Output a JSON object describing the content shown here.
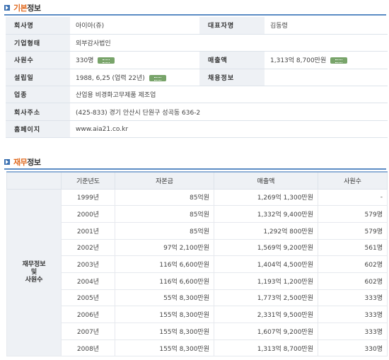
{
  "basic_section": {
    "title_accent": "기본",
    "title_rest": "정보"
  },
  "basic": {
    "rows": [
      {
        "label": "회사명",
        "value": "아이아(쥬)",
        "label2": "대표자명",
        "value2": "김동령"
      },
      {
        "label": "기업형태",
        "value": "외부감사법인"
      },
      {
        "label": "사원수",
        "value": "330명",
        "label2": "매출액",
        "value2": "1,313억 8,700만원"
      },
      {
        "label": "설립일",
        "value": "1988, 6,25 (업력 22년)",
        "label2": "채용정보",
        "value2": ""
      },
      {
        "label": "업종",
        "value": "산업용 비경화고무제품 제조업"
      },
      {
        "label": "회사주소",
        "value": "(425-833) 경기 안산시 단원구 성곡동 636-2"
      },
      {
        "label": "홈페이지",
        "value": "www.aia21.co.kr"
      }
    ]
  },
  "finance_section": {
    "title_accent": "재무",
    "title_rest": "정보"
  },
  "finance": {
    "side_label_lines": [
      "재무정보",
      "및",
      "사원수"
    ],
    "headers": [
      "기준년도",
      "자본금",
      "매출액",
      "사원수"
    ],
    "rows": [
      {
        "year": "1999년",
        "capital": "85억원",
        "sales": "1,269억 1,300만원",
        "employees": "-"
      },
      {
        "year": "2000년",
        "capital": "85억원",
        "sales": "1,332억 9,400만원",
        "employees": "579명"
      },
      {
        "year": "2001년",
        "capital": "85억원",
        "sales": "1,292억 800만원",
        "employees": "579명"
      },
      {
        "year": "2002년",
        "capital": "97억 2,100만원",
        "sales": "1,569억 9,200만원",
        "employees": "561명"
      },
      {
        "year": "2003년",
        "capital": "116억 6,600만원",
        "sales": "1,404억 4,500만원",
        "employees": "602명"
      },
      {
        "year": "2004년",
        "capital": "116억 6,600만원",
        "sales": "1,193억 1,200만원",
        "employees": "602명"
      },
      {
        "year": "2005년",
        "capital": "55억 8,300만원",
        "sales": "1,773억 2,500만원",
        "employees": "333명"
      },
      {
        "year": "2006년",
        "capital": "155억 8,300만원",
        "sales": "2,331억 9,500만원",
        "employees": "333명"
      },
      {
        "year": "2007년",
        "capital": "155억 8,300만원",
        "sales": "1,607억 9,200만원",
        "employees": "333명"
      },
      {
        "year": "2008년",
        "capital": "155억 8,300만원",
        "sales": "1,313억 8,700만원",
        "employees": "330명"
      }
    ]
  },
  "icons": {
    "section_bullet": "arrow-bullet-icon",
    "badge": "graph-badge-icon"
  },
  "colors": {
    "accent": "#e06a1f",
    "rule": "#5b8cc4",
    "label_bg": "#eef1f5",
    "badge": "#78a46a"
  }
}
